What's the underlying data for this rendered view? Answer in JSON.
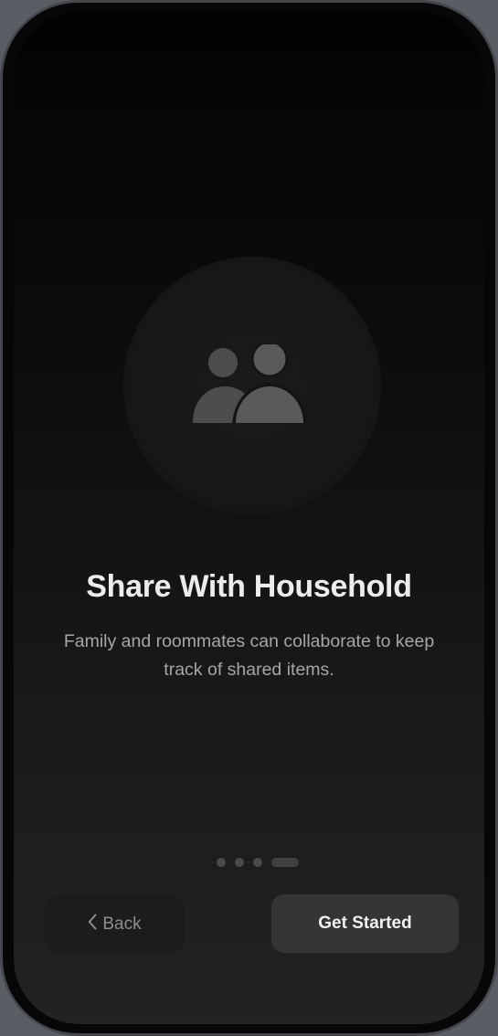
{
  "onboarding": {
    "title": "Share With Household",
    "subtitle": "Family and roommates can collaborate to keep track of shared items.",
    "hero_icon": "two-people-icon",
    "pagination": {
      "total_pages": 4,
      "current_page": 4
    },
    "back_button": {
      "label": "Back",
      "icon": "chevron-left-icon"
    },
    "primary_button": {
      "label": "Get Started"
    }
  },
  "colors": {
    "title": "#ececec",
    "subtitle": "#a6a6a6",
    "primary_button_bg": "#343434",
    "back_button_bg": "#1c1c1c"
  }
}
